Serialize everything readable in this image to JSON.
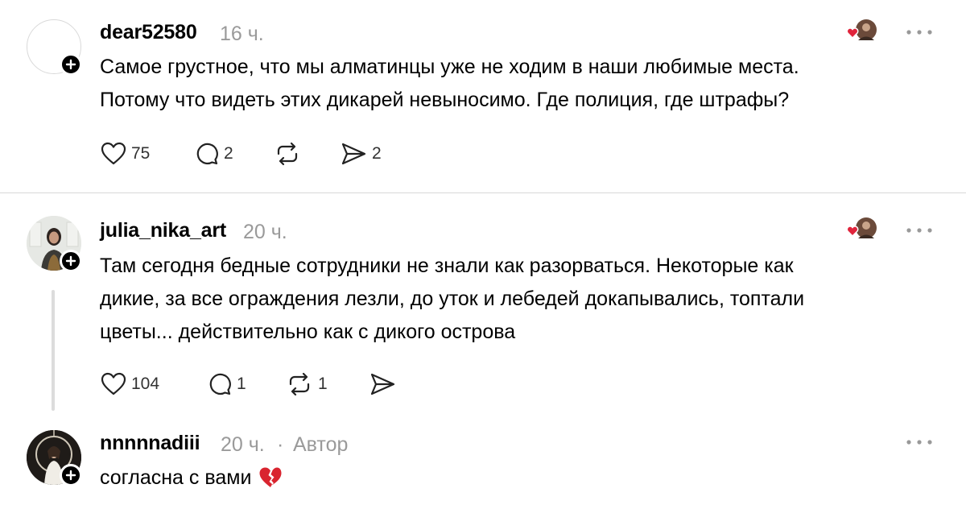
{
  "colors": {
    "background": "#ffffff",
    "text": "#000000",
    "muted": "#9a9a9a",
    "divider": "#d8d8d8",
    "heart_red": "#e0243c"
  },
  "comments": [
    {
      "username": "dear52580",
      "time": "16 ч.",
      "text_lines": [
        "Самое грустное, что мы алматинцы уже не ходим в наши любимые места.",
        "Потому что видеть этих дикарей невыносимо. Где полиция, где штрафы?"
      ],
      "likes": "75",
      "replies": "2",
      "reposts": "",
      "shares": "2",
      "avatar_icon": "empty-avatar",
      "liked_by_author": true
    },
    {
      "username": "julia_nika_art",
      "time": "20 ч.",
      "text_lines": [
        "Там сегодня бедные сотрудники не знали как разорваться. Некоторые как",
        "дикие, за все ограждения лезли, до уток и лебедей докапывались, топтали",
        "цветы... действительно как с дикого острова"
      ],
      "likes": "104",
      "replies": "1",
      "reposts": "1",
      "shares": "",
      "avatar_icon": "user-photo-avatar",
      "liked_by_author": true
    },
    {
      "username": "nnnnnadiii",
      "time": "20 ч.",
      "separator": "·",
      "badge": "Автор",
      "text_lines": [
        "согласна с вами"
      ],
      "emoji": "broken-heart-icon",
      "avatar_icon": "user-photo-avatar"
    }
  ]
}
